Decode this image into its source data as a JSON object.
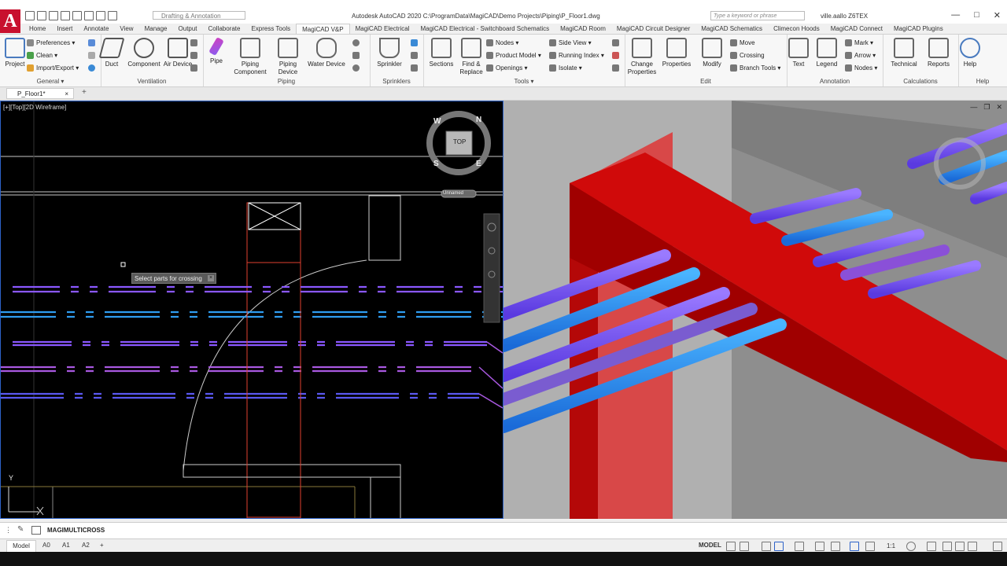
{
  "app": {
    "logo_letter": "A",
    "workspace": "Drafting & Annotation",
    "title": "Autodesk AutoCAD 2020   C:\\ProgramData\\MagiCAD\\Demo Projects\\Piping\\P_Floor1.dwg",
    "search_placeholder": "Type a keyword or phrase",
    "user": "ville.aallo Z6TEX"
  },
  "ribbon_tabs": [
    "Home",
    "Insert",
    "Annotate",
    "View",
    "Manage",
    "Output",
    "Collaborate",
    "Express Tools",
    "MagiCAD V&P",
    "MagiCAD Electrical",
    "MagiCAD Electrical - Switchboard Schematics",
    "MagiCAD Room",
    "MagiCAD Circuit Designer",
    "MagiCAD Schematics",
    "Climecon Hoods",
    "MagiCAD Connect",
    "MagiCAD Plugins"
  ],
  "active_tab": "MagiCAD V&P",
  "ribbon": {
    "general": {
      "label": "General",
      "project": "Project",
      "preferences": "Preferences",
      "clean": "Clean",
      "import_export": "Import/Export"
    },
    "ventilation": {
      "label": "Ventilation",
      "duct": "Duct",
      "component": "Component",
      "air_device": "Air Device"
    },
    "piping": {
      "label": "Piping",
      "pipe": "Pipe",
      "piping_component": "Piping Component",
      "piping_device": "Piping Device",
      "water_device": "Water Device"
    },
    "sprinklers": {
      "label": "Sprinklers",
      "sprinkler": "Sprinkler"
    },
    "tools": {
      "label": "Tools",
      "sections": "Sections",
      "find_replace": "Find & Replace",
      "nodes": "Nodes",
      "product_model": "Product Model",
      "openings": "Openings",
      "side_view": "Side View",
      "running_index": "Running Index",
      "isolate": "Isolate"
    },
    "edit": {
      "label": "Edit",
      "change_properties": "Change Properties",
      "properties": "Properties",
      "modify": "Modify",
      "move": "Move",
      "crossing": "Crossing",
      "branch_tools": "Branch Tools"
    },
    "annotation": {
      "label": "Annotation",
      "text": "Text",
      "legend": "Legend",
      "mark": "Mark",
      "arrow": "Arrow",
      "nodes": "Nodes"
    },
    "calculations": {
      "label": "Calculations",
      "technical": "Technical",
      "reports": "Reports"
    },
    "help": {
      "label": "Help",
      "help": "Help"
    }
  },
  "document_tab": "P_Floor1*",
  "viewport_left": {
    "label": "[+][Top][2D Wireframe]",
    "viewcube": "TOP",
    "compass": {
      "n": "N",
      "e": "E",
      "s": "S",
      "w": "W"
    },
    "ucs_name": "Unnamed",
    "tooltip": "Select parts for crossing",
    "axis_y": "Y"
  },
  "command_line": "MAGIMULTICROSS",
  "layout_tabs": [
    "Model",
    "A0",
    "A1",
    "A2"
  ],
  "status": {
    "model": "MODEL",
    "scale": "1:1"
  },
  "colors": {
    "accent": "#c8102e",
    "pipe_violet": "#7a4cff",
    "pipe_blue": "#2f8df0",
    "beam_red": "#c40a0a",
    "viewport_border": "#2d62c8"
  }
}
